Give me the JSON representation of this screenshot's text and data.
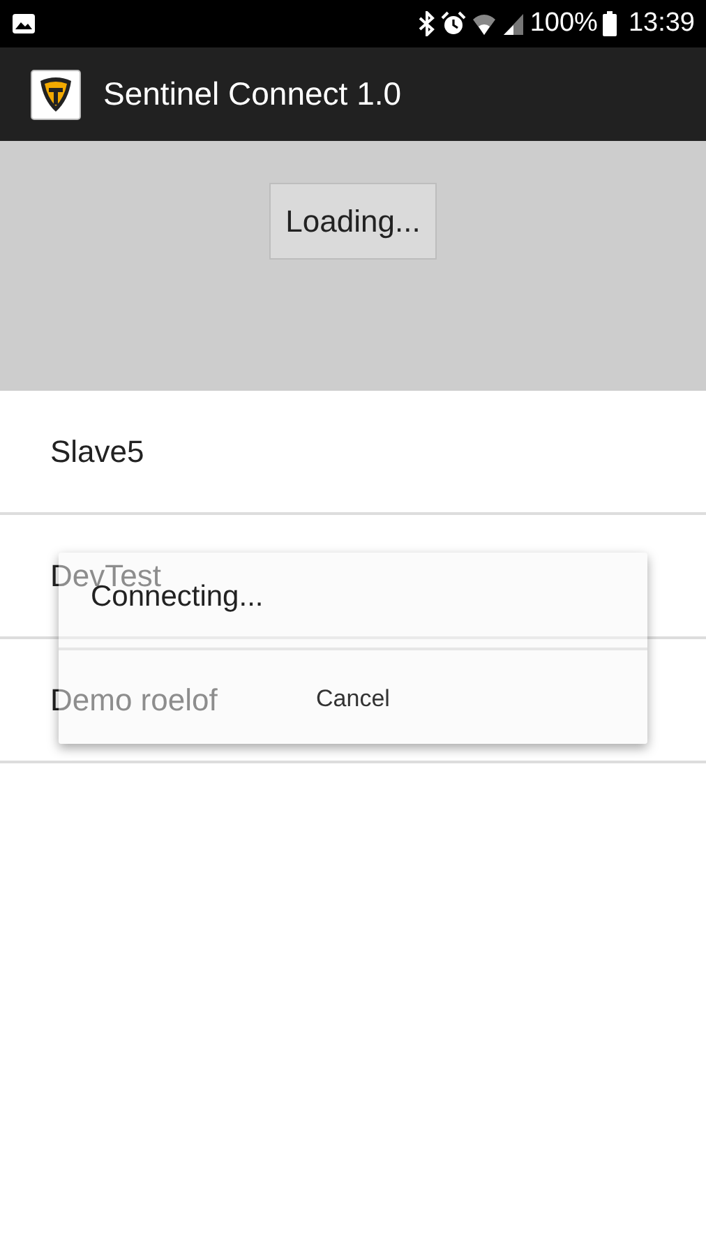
{
  "status_bar": {
    "battery": "100%",
    "time": "13:39"
  },
  "app_bar": {
    "title": "Sentinel Connect 1.0"
  },
  "header": {
    "button": "Loading..."
  },
  "devices": [
    {
      "name": "Slave5"
    },
    {
      "name": "DevTest"
    },
    {
      "name": "Demo roelof"
    }
  ],
  "dialog": {
    "message": "Connecting...",
    "button": "Cancel"
  }
}
